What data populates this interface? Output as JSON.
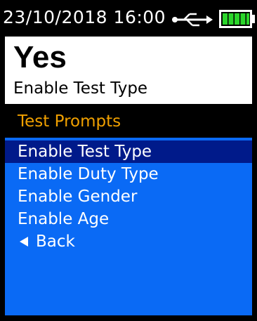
{
  "status_bar": {
    "datetime": "23/10/2018 16:00",
    "usb_icon": "usb-icon",
    "battery_icon": "battery-icon",
    "battery_color": "#2bd62b"
  },
  "value_panel": {
    "value": "Yes",
    "setting_name": "Enable Test Type"
  },
  "menu": {
    "header": "Test Prompts",
    "header_color": "#f0a000",
    "background_color": "#0a6af5",
    "selected_color": "#001a8a",
    "items": [
      {
        "label": "Enable Test Type",
        "selected": true
      },
      {
        "label": "Enable Duty Type",
        "selected": false
      },
      {
        "label": "Enable Gender",
        "selected": false
      },
      {
        "label": "Enable Age",
        "selected": false
      }
    ],
    "back": {
      "label": "Back",
      "icon": "triangle-left-icon"
    }
  }
}
